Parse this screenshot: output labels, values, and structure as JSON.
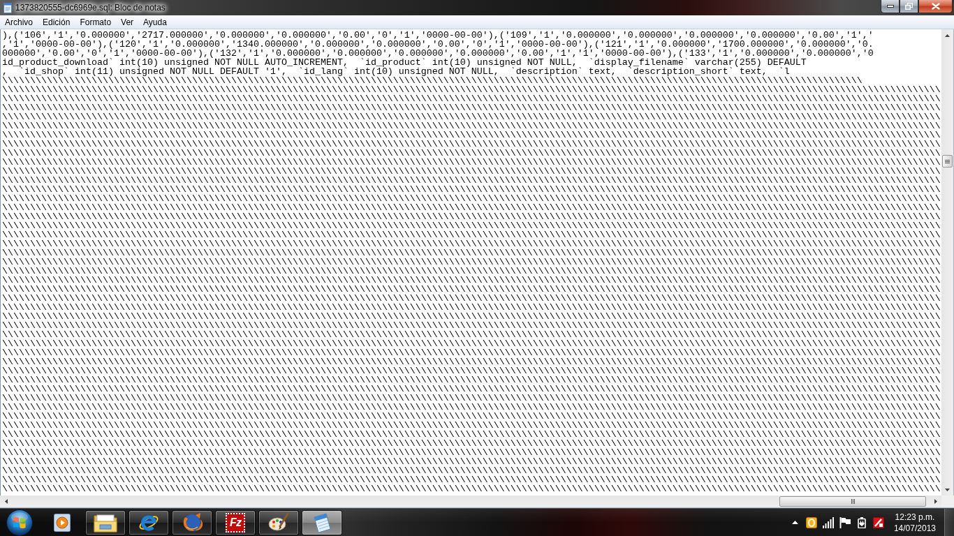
{
  "window": {
    "title": "1373820555-dc6969e.sql: Bloc de notas"
  },
  "menu": [
    "Archivo",
    "Edición",
    "Formato",
    "Ver",
    "Ayuda"
  ],
  "editor": {
    "lines": [
      {
        "parts": [
          "),('106','1','0.000000','2717.000000','0.000000','0.000000','0.00','0','1','0000-00-00'),('109','1','0.000000','0.000000','0.000000','0.000000','0.00','1','"
        ]
      },
      {
        "parts": [
          ",'1','0000-00-00'),('120','1','0.000000','1340.000000','0.000000','0.000000','0.00','0','1','0000-00-00'),('121','1','0.000000','1700.000000','0.000000','0."
        ]
      },
      {
        "parts": [
          "000000','0.00','0','1','0000-00-00'),('132','1','0.000000','0.000000','0.000000','0.000000','0.00','1','1','0000-00-00'),('133','1','0.000000','0.000000','0"
        ]
      },
      {
        "parts": [
          "id_product_download` int(10) unsigned NOT NULL AUTO_INCREMENT,  `id_product` int(10) unsigned NOT NULL,  `display_filename` varchar(255) DEFAULT"
        ]
      },
      {
        "parts": [
          ",  `id_shop` int(11) unsigned NOT NULL DEFAULT '1',  `id_lang` int(10) unsigned NOT NULL,  `description` text,  `description_short` text,  `l"
        ]
      },
      {
        "parts": [
          "\\\\\\\\\\\\\\\\",
          "\\\\\\\\\\\\\\\\",
          "\\\\\\\\\\\\\\\\",
          "\\\\\\\\\\\\\\\\",
          "\\\\\\\\\\\\\\\\",
          "\\\\\\\\\\\\\\\\",
          "\\\\\\\\\\\\\\\\",
          "\\\\\\\\\\\\\\\\",
          "\\\\\\\\\\\\\\\\",
          "\\\\\\\\\\\\\\\\",
          "\\\\\\\\\\\\\\\\",
          "\\\\\\\\\\\\\\\\",
          "\\\\\\\\\\\\\\\\",
          "\\\\\\\\\\\\\\\\",
          "\\\\\\\\\\\\\\\\",
          "\\\\\\\\\\\\\\\\",
          "\\\\\\\\\\\\\\\\",
          "\\\\\\\\\\\\\\\\",
          "\\\\\\\\\\\\\\\\",
          "\\\\"
        ]
      },
      {
        "parts": [
          "\\\\\\\\\\\\\\\\",
          "\\\\\\\\\\\\\\\\",
          "\\\\\\\\\\\\\\\\",
          "\\\\\\\\\\\\\\\\",
          "\\\\\\\\\\\\\\\\",
          "\\\\\\\\\\\\\\\\",
          "\\\\\\\\\\\\\\\\",
          "\\\\\\\\\\\\\\\\",
          "\\\\\\\\\\\\\\\\",
          "\\\\\\\\\\\\\\\\",
          "\\\\\\\\\\\\\\\\",
          "\\\\\\\\\\\\\\\\",
          "\\\\\\\\\\\\\\\\",
          "\\\\\\\\\\\\\\\\",
          "\\\\\\\\\\\\\\\\",
          "\\\\\\\\\\\\\\\\",
          "\\\\\\\\\\\\\\\\",
          "\\\\\\\\\\\\\\\\",
          "\\\\\\\\\\\\\\\\",
          "\\\\\\\\\\\\\\\\",
          "\\\\\\\\\\\\\\\\"
        ]
      },
      {
        "parts": [
          "\\\\\\\\\\\\\\\\",
          "\\\\\\\\\\\\\\\\",
          "\\\\\\\\\\\\\\\\",
          "\\\\\\\\\\\\\\\\",
          "\\\\\\\\\\\\\\\\",
          "\\\\\\\\\\\\\\\\",
          "\\\\\\\\\\\\\\\\",
          "\\\\\\\\\\\\\\\\",
          "\\\\\\\\\\\\\\\\",
          "\\\\\\\\\\\\\\\\",
          "\\\\\\\\\\\\\\\\",
          "\\\\\\\\\\\\\\\\",
          "\\\\\\\\\\\\\\\\",
          "\\\\\\\\\\\\\\\\",
          "\\\\\\\\\\\\\\\\",
          "\\\\\\\\\\\\\\\\",
          "\\\\\\\\\\\\\\\\",
          "\\\\\\\\\\\\\\\\",
          "\\\\\\\\\\\\\\\\",
          "\\\\\\\\\\\\\\\\",
          "\\\\\\\\\\\\\\\\"
        ]
      },
      {
        "parts": [
          "\\\\\\\\\\\\\\\\",
          "\\\\\\\\\\\\\\\\",
          "\\\\\\\\\\\\\\\\",
          "\\\\\\\\\\\\\\\\",
          "\\\\\\\\\\\\\\\\",
          "\\\\\\\\\\\\\\\\",
          "\\\\\\\\\\\\\\\\",
          "\\\\\\\\\\\\\\\\",
          "\\\\\\\\\\\\\\\\",
          "\\\\\\\\\\\\\\\\",
          "\\\\\\\\\\\\\\\\",
          "\\\\\\\\\\\\\\\\",
          "\\\\\\\\\\\\\\\\",
          "\\\\\\\\\\\\\\\\",
          "\\\\\\\\\\\\\\\\",
          "\\\\\\\\\\\\\\\\",
          "\\\\\\\\\\\\\\\\",
          "\\\\\\\\\\\\\\\\",
          "\\\\\\\\\\\\\\\\",
          "\\\\\\\\\\\\\\\\",
          "\\\\\\\\\\\\\\\\"
        ]
      },
      {
        "parts": [
          "\\\\\\\\\\\\\\\\",
          "\\\\\\\\\\\\\\\\",
          "\\\\\\\\\\\\\\\\",
          "\\\\\\\\\\\\\\\\",
          "\\\\\\\\\\\\\\\\",
          "\\\\\\\\\\\\\\\\",
          "\\\\\\\\\\\\\\\\",
          "\\\\\\\\\\\\\\\\",
          "\\\\\\\\\\\\\\\\",
          "\\\\\\\\\\\\\\\\",
          "\\\\\\\\\\\\\\\\",
          "\\\\\\\\\\\\\\\\",
          "\\\\\\\\\\\\\\\\",
          "\\\\\\\\\\\\\\\\",
          "\\\\\\\\\\\\\\\\",
          "\\\\\\\\\\\\\\\\",
          "\\\\\\\\\\\\\\\\",
          "\\\\\\\\\\\\\\\\",
          "\\\\\\\\\\\\\\\\",
          "\\\\\\\\\\\\\\\\",
          "\\\\\\\\\\\\\\\\"
        ]
      },
      {
        "parts": [
          "\\\\\\\\\\\\\\\\",
          "\\\\\\\\\\\\\\\\",
          "\\\\\\\\\\\\\\\\",
          "\\\\\\\\\\\\\\\\",
          "\\\\\\\\\\\\\\\\",
          "\\\\\\\\\\\\\\\\",
          "\\\\\\\\\\\\\\\\",
          "\\\\\\\\\\\\\\\\",
          "\\\\\\\\\\\\\\\\",
          "\\\\\\\\\\\\\\\\",
          "\\\\\\\\\\\\\\\\",
          "\\\\\\\\\\\\\\\\",
          "\\\\\\\\\\\\\\\\",
          "\\\\\\\\\\\\\\\\",
          "\\\\\\\\\\\\\\\\",
          "\\\\\\\\\\\\\\\\",
          "\\\\\\\\\\\\\\\\",
          "\\\\\\\\\\\\\\\\",
          "\\\\\\\\\\\\\\\\",
          "\\\\\\\\\\\\\\\\",
          "\\\\\\\\\\\\\\\\"
        ]
      },
      {
        "parts": [
          "\\\\\\\\\\\\\\\\",
          "\\\\\\\\\\\\\\\\",
          "\\\\\\\\\\\\\\\\",
          "\\\\\\\\\\\\\\\\",
          "\\\\\\\\\\\\\\\\",
          "\\\\\\\\\\\\\\\\",
          "\\\\\\\\\\\\\\\\",
          "\\\\\\\\\\\\\\\\",
          "\\\\\\\\\\\\\\\\",
          "\\\\\\\\\\\\\\\\",
          "\\\\\\\\\\\\\\\\",
          "\\\\\\\\\\\\\\\\",
          "\\\\\\\\\\\\\\\\",
          "\\\\\\\\\\\\\\\\",
          "\\\\\\\\\\\\\\\\",
          "\\\\\\\\\\\\\\\\",
          "\\\\\\\\\\\\\\\\",
          "\\\\\\\\\\\\\\\\",
          "\\\\\\\\\\\\\\\\",
          "\\\\\\\\\\\\\\\\",
          "\\\\\\\\\\\\\\\\"
        ]
      },
      {
        "parts": [
          "\\\\\\\\\\\\\\\\",
          "\\\\\\\\\\\\\\\\",
          "\\\\\\\\\\\\\\\\",
          "\\\\\\\\\\\\\\\\",
          "\\\\\\\\\\\\\\\\",
          "\\\\\\\\\\\\\\\\",
          "\\\\\\\\\\\\\\\\",
          "\\\\\\\\\\\\\\\\",
          "\\\\\\\\\\\\\\\\",
          "\\\\\\\\\\\\\\\\",
          "\\\\\\\\\\\\\\\\",
          "\\\\\\\\\\\\\\\\",
          "\\\\\\\\\\\\\\\\",
          "\\\\\\\\\\\\\\\\",
          "\\\\\\\\\\\\\\\\",
          "\\\\\\\\\\\\\\\\",
          "\\\\\\\\\\\\\\\\",
          "\\\\\\\\\\\\\\\\",
          "\\\\\\\\\\\\\\\\",
          "\\\\\\\\\\\\\\\\",
          "\\\\\\\\\\\\\\\\"
        ]
      },
      {
        "parts": [
          "\\\\\\\\\\\\\\\\",
          "\\\\\\\\\\\\\\\\",
          "\\\\\\\\\\\\\\\\",
          "\\\\\\\\\\\\\\\\",
          "\\\\\\\\\\\\\\\\",
          "\\\\\\\\\\\\\\\\",
          "\\\\\\\\\\\\\\\\",
          "\\\\\\\\\\\\\\\\",
          "\\\\\\\\\\\\\\\\",
          "\\\\\\\\\\\\\\\\",
          "\\\\\\\\\\\\\\\\",
          "\\\\\\\\\\\\\\\\",
          "\\\\\\\\\\\\\\\\",
          "\\\\\\\\\\\\\\\\",
          "\\\\\\\\\\\\\\\\",
          "\\\\\\\\\\\\\\\\",
          "\\\\\\\\\\\\\\\\",
          "\\\\\\\\\\\\\\\\",
          "\\\\\\\\\\\\\\\\",
          "\\\\\\\\\\\\\\\\",
          "\\\\\\\\\\\\\\\\"
        ]
      },
      {
        "parts": [
          "\\\\\\\\\\\\\\\\",
          "\\\\\\\\\\\\\\\\",
          "\\\\\\\\\\\\\\\\",
          "\\\\\\\\\\\\\\\\",
          "\\\\\\\\\\\\\\\\",
          "\\\\\\\\\\\\\\\\",
          "\\\\\\\\\\\\\\\\",
          "\\\\\\\\\\\\\\\\",
          "\\\\\\\\\\\\\\\\",
          "\\\\\\\\\\\\\\\\",
          "\\\\\\\\\\\\\\\\",
          "\\\\\\\\\\\\\\\\",
          "\\\\\\\\\\\\\\\\",
          "\\\\\\\\\\\\\\\\",
          "\\\\\\\\\\\\\\\\",
          "\\\\\\\\\\\\\\\\",
          "\\\\\\\\\\\\\\\\",
          "\\\\\\\\\\\\\\\\",
          "\\\\\\\\\\\\\\\\",
          "\\\\\\\\\\\\\\\\",
          "\\\\\\\\\\\\\\\\"
        ]
      },
      {
        "parts": [
          "\\\\\\\\\\\\\\\\",
          "\\\\\\\\\\\\\\\\",
          "\\\\\\\\\\\\\\\\",
          "\\\\\\\\\\\\\\\\",
          "\\\\\\\\\\\\\\\\",
          "\\\\\\\\\\\\\\\\",
          "\\\\\\\\\\\\\\\\",
          "\\\\\\\\\\\\\\\\",
          "\\\\\\\\\\\\\\\\",
          "\\\\\\\\\\\\\\\\",
          "\\\\\\\\\\\\\\\\",
          "\\\\\\\\\\\\\\\\",
          "\\\\\\\\\\\\\\\\",
          "\\\\\\\\\\\\\\\\",
          "\\\\\\\\\\\\\\\\",
          "\\\\\\\\\\\\\\\\",
          "\\\\\\\\\\\\\\\\",
          "\\\\\\\\\\\\\\\\",
          "\\\\\\\\\\\\\\\\",
          "\\\\\\\\\\\\\\\\",
          "\\\\\\\\\\\\\\\\"
        ]
      },
      {
        "parts": [
          "\\\\\\\\\\\\\\\\",
          "\\\\\\\\\\\\\\\\",
          "\\\\\\\\\\\\\\\\",
          "\\\\\\\\\\\\\\\\",
          "\\\\\\\\\\\\\\\\",
          "\\\\\\\\\\\\\\\\",
          "\\\\\\\\\\\\\\\\",
          "\\\\\\\\\\\\\\\\",
          "\\\\\\\\\\\\\\\\",
          "\\\\\\\\\\\\\\\\",
          "\\\\\\\\\\\\\\\\",
          "\\\\\\\\\\\\\\\\",
          "\\\\\\\\\\\\\\\\",
          "\\\\\\\\\\\\\\\\",
          "\\\\\\\\\\\\\\\\",
          "\\\\\\\\\\\\\\\\",
          "\\\\\\\\\\\\\\\\",
          "\\\\\\\\\\\\\\\\",
          "\\\\\\\\\\\\\\\\",
          "\\\\\\\\\\\\\\\\",
          "\\\\\\\\\\\\\\\\"
        ]
      },
      {
        "parts": [
          "\\\\\\\\\\\\\\\\",
          "\\\\\\\\\\\\\\\\",
          "\\\\\\\\\\\\\\\\",
          "\\\\\\\\\\\\\\\\",
          "\\\\\\\\\\\\\\\\",
          "\\\\\\\\\\\\\\\\",
          "\\\\\\\\\\\\\\\\",
          "\\\\\\\\\\\\\\\\",
          "\\\\\\\\\\\\\\\\",
          "\\\\\\\\\\\\\\\\",
          "\\\\\\\\\\\\\\\\",
          "\\\\\\\\\\\\\\\\",
          "\\\\\\\\\\\\\\\\",
          "\\\\\\\\\\\\\\\\",
          "\\\\\\\\\\\\\\\\",
          "\\\\\\\\\\\\\\\\",
          "\\\\\\\\\\\\\\\\",
          "\\\\\\\\\\\\\\\\",
          "\\\\\\\\\\\\\\\\",
          "\\\\\\\\\\\\\\\\",
          "\\\\\\\\\\\\\\\\"
        ]
      },
      {
        "parts": [
          "\\\\\\\\\\\\\\\\",
          "\\\\\\\\\\\\\\\\",
          "\\\\\\\\\\\\\\\\",
          "\\\\\\\\\\\\\\\\",
          "\\\\\\\\\\\\\\\\",
          "\\\\\\\\\\\\\\\\",
          "\\\\\\\\\\\\\\\\",
          "\\\\\\\\\\\\\\\\",
          "\\\\\\\\\\\\\\\\",
          "\\\\\\\\\\\\\\\\",
          "\\\\\\\\\\\\\\\\",
          "\\\\\\\\\\\\\\\\",
          "\\\\\\\\\\\\\\\\",
          "\\\\\\\\\\\\\\\\",
          "\\\\\\\\\\\\\\\\",
          "\\\\\\\\\\\\\\\\",
          "\\\\\\\\\\\\\\\\",
          "\\\\\\\\\\\\\\\\",
          "\\\\\\\\\\\\\\\\",
          "\\\\\\\\\\\\\\\\",
          "\\\\\\\\\\\\\\\\"
        ]
      },
      {
        "parts": [
          "\\\\\\\\\\\\\\\\",
          "\\\\\\\\\\\\\\\\",
          "\\\\\\\\\\\\\\\\",
          "\\\\\\\\\\\\\\\\",
          "\\\\\\\\\\\\\\\\",
          "\\\\\\\\\\\\\\\\",
          "\\\\\\\\\\\\\\\\",
          "\\\\\\\\\\\\\\\\",
          "\\\\\\\\\\\\\\\\",
          "\\\\\\\\\\\\\\\\",
          "\\\\\\\\\\\\\\\\",
          "\\\\\\\\\\\\\\\\",
          "\\\\\\\\\\\\\\\\",
          "\\\\\\\\\\\\\\\\",
          "\\\\\\\\\\\\\\\\",
          "\\\\\\\\\\\\\\\\",
          "\\\\\\\\\\\\\\\\",
          "\\\\\\\\\\\\\\\\",
          "\\\\\\\\\\\\\\\\",
          "\\\\\\\\\\\\\\\\",
          "\\\\\\\\\\\\\\\\"
        ]
      },
      {
        "parts": [
          "\\\\\\\\\\\\\\\\",
          "\\\\\\\\\\\\\\\\",
          "\\\\\\\\\\\\\\\\",
          "\\\\\\\\\\\\\\\\",
          "\\\\\\\\\\\\\\\\",
          "\\\\\\\\\\\\\\\\",
          "\\\\\\\\\\\\\\\\",
          "\\\\\\\\\\\\\\\\",
          "\\\\\\\\\\\\\\\\",
          "\\\\\\\\\\\\\\\\",
          "\\\\\\\\\\\\\\\\",
          "\\\\\\\\\\\\\\\\",
          "\\\\\\\\\\\\\\\\",
          "\\\\\\\\\\\\\\\\",
          "\\\\\\\\\\\\\\\\",
          "\\\\\\\\\\\\\\\\",
          "\\\\\\\\\\\\\\\\",
          "\\\\\\\\\\\\\\\\",
          "\\\\\\\\\\\\\\\\",
          "\\\\\\\\\\\\\\\\",
          "\\\\\\\\\\\\\\\\"
        ]
      },
      {
        "parts": [
          "\\\\\\\\\\\\\\\\",
          "\\\\\\\\\\\\\\\\",
          "\\\\\\\\\\\\\\\\",
          "\\\\\\\\\\\\\\\\",
          "\\\\\\\\\\\\\\\\",
          "\\\\\\\\\\\\\\\\",
          "\\\\\\\\\\\\\\\\",
          "\\\\\\\\\\\\\\\\",
          "\\\\\\\\\\\\\\\\",
          "\\\\\\\\\\\\\\\\",
          "\\\\\\\\\\\\\\\\",
          "\\\\\\\\\\\\\\\\",
          "\\\\\\\\\\\\\\\\",
          "\\\\\\\\\\\\\\\\",
          "\\\\\\\\\\\\\\\\",
          "\\\\\\\\\\\\\\\\",
          "\\\\\\\\\\\\\\\\",
          "\\\\\\\\\\\\\\\\",
          "\\\\\\\\\\\\\\\\",
          "\\\\\\\\\\\\\\\\",
          "\\\\\\\\\\\\\\\\"
        ]
      },
      {
        "parts": [
          "\\\\\\\\\\\\\\\\",
          "\\\\\\\\\\\\\\\\",
          "\\\\\\\\\\\\\\\\",
          "\\\\\\\\\\\\\\\\",
          "\\\\\\\\\\\\\\\\",
          "\\\\\\\\\\\\\\\\",
          "\\\\\\\\\\\\\\\\",
          "\\\\\\\\\\\\\\\\",
          "\\\\\\\\\\\\\\\\",
          "\\\\\\\\\\\\\\\\",
          "\\\\\\\\\\\\\\\\",
          "\\\\\\\\\\\\\\\\",
          "\\\\\\\\\\\\\\\\",
          "\\\\\\\\\\\\\\\\",
          "\\\\\\\\\\\\\\\\",
          "\\\\\\\\\\\\\\\\",
          "\\\\\\\\\\\\\\\\",
          "\\\\\\\\\\\\\\\\",
          "\\\\\\\\\\\\\\\\",
          "\\\\\\\\\\\\\\\\",
          "\\\\\\\\\\\\\\\\"
        ]
      },
      {
        "parts": [
          "\\\\\\\\\\\\\\\\",
          "\\\\\\\\\\\\\\\\",
          "\\\\\\\\\\\\\\\\",
          "\\\\\\\\\\\\\\\\",
          "\\\\\\\\\\\\\\\\",
          "\\\\\\\\\\\\\\\\",
          "\\\\\\\\\\\\\\\\",
          "\\\\\\\\\\\\\\\\",
          "\\\\\\\\\\\\\\\\",
          "\\\\\\\\\\\\\\\\",
          "\\\\\\\\\\\\\\\\",
          "\\\\\\\\\\\\\\\\",
          "\\\\\\\\\\\\\\\\",
          "\\\\\\\\\\\\\\\\",
          "\\\\\\\\\\\\\\\\",
          "\\\\\\\\\\\\\\\\",
          "\\\\\\\\\\\\\\\\",
          "\\\\\\\\\\\\\\\\",
          "\\\\\\\\\\\\\\\\",
          "\\\\\\\\\\\\\\\\",
          "\\\\\\\\\\\\\\\\"
        ]
      },
      {
        "parts": [
          "\\\\\\\\\\\\\\\\",
          "\\\\\\\\\\\\\\\\",
          "\\\\\\\\\\\\\\\\",
          "\\\\\\\\\\\\\\\\",
          "\\\\\\\\\\\\\\\\",
          "\\\\\\\\\\\\\\\\",
          "\\\\\\\\\\\\\\\\",
          "\\\\\\\\\\\\\\\\",
          "\\\\\\\\\\\\\\\\",
          "\\\\\\\\\\\\\\\\",
          "\\\\\\\\\\\\\\\\",
          "\\\\\\\\\\\\\\\\",
          "\\\\\\\\\\\\\\\\",
          "\\\\\\\\\\\\\\\\",
          "\\\\\\\\\\\\\\\\",
          "\\\\\\\\\\\\\\\\",
          "\\\\\\\\\\\\\\\\",
          "\\\\\\\\\\\\\\\\",
          "\\\\\\\\\\\\\\\\",
          "\\\\\\\\\\\\\\\\",
          "\\\\\\\\\\\\\\\\"
        ]
      },
      {
        "parts": [
          "\\\\\\\\\\\\\\\\",
          "\\\\\\\\\\\\\\\\",
          "\\\\\\\\\\\\\\\\",
          "\\\\\\\\\\\\\\\\",
          "\\\\\\\\\\\\\\\\",
          "\\\\\\\\\\\\\\\\",
          "\\\\\\\\\\\\\\\\",
          "\\\\\\\\\\\\\\\\",
          "\\\\\\\\\\\\\\\\",
          "\\\\\\\\\\\\\\\\",
          "\\\\\\\\\\\\\\\\",
          "\\\\\\\\\\\\\\\\",
          "\\\\\\\\\\\\\\\\",
          "\\\\\\\\\\\\\\\\",
          "\\\\\\\\\\\\\\\\",
          "\\\\\\\\\\\\\\\\",
          "\\\\\\\\\\\\\\\\",
          "\\\\\\\\\\\\\\\\",
          "\\\\\\\\\\\\\\\\",
          "\\\\\\\\\\\\\\\\",
          "\\\\\\\\\\\\\\\\"
        ]
      },
      {
        "parts": [
          "\\\\\\\\\\\\\\\\",
          "\\\\\\\\\\\\\\\\",
          "\\\\\\\\\\\\\\\\",
          "\\\\\\\\\\\\\\\\",
          "\\\\\\\\\\\\\\\\",
          "\\\\\\\\\\\\\\\\",
          "\\\\\\\\\\\\\\\\",
          "\\\\\\\\\\\\\\\\",
          "\\\\\\\\\\\\\\\\",
          "\\\\\\\\\\\\\\\\",
          "\\\\\\\\\\\\\\\\",
          "\\\\\\\\\\\\\\\\",
          "\\\\\\\\\\\\\\\\",
          "\\\\\\\\\\\\\\\\",
          "\\\\\\\\\\\\\\\\",
          "\\\\\\\\\\\\\\\\",
          "\\\\\\\\\\\\\\\\",
          "\\\\\\\\\\\\\\\\",
          "\\\\\\\\\\\\\\\\",
          "\\\\\\\\\\\\\\\\",
          "\\\\\\\\\\\\\\\\"
        ]
      },
      {
        "parts": [
          "\\\\\\\\\\\\\\\\",
          "\\\\\\\\\\\\\\\\",
          "\\\\\\\\\\\\\\\\",
          "\\\\\\\\\\\\\\\\",
          "\\\\\\\\\\\\\\\\",
          "\\\\\\\\\\\\\\\\",
          "\\\\\\\\\\\\\\\\",
          "\\\\\\\\\\\\\\\\",
          "\\\\\\\\\\\\\\\\",
          "\\\\\\\\\\\\\\\\",
          "\\\\\\\\\\\\\\\\",
          "\\\\\\\\\\\\\\\\",
          "\\\\\\\\\\\\\\\\",
          "\\\\\\\\\\\\\\\\",
          "\\\\\\\\\\\\\\\\",
          "\\\\\\\\\\\\\\\\",
          "\\\\\\\\\\\\\\\\",
          "\\\\\\\\\\\\\\\\",
          "\\\\\\\\\\\\\\\\",
          "\\\\\\\\\\\\\\\\",
          "\\\\\\\\\\\\\\\\"
        ]
      },
      {
        "parts": [
          "\\\\\\\\\\\\\\\\",
          "\\\\\\\\\\\\\\\\",
          "\\\\\\\\\\\\\\\\",
          "\\\\\\\\\\\\\\\\",
          "\\\\\\\\\\\\\\\\",
          "\\\\\\\\\\\\\\\\",
          "\\\\\\\\\\\\\\\\",
          "\\\\\\\\\\\\\\\\",
          "\\\\\\\\\\\\\\\\",
          "\\\\\\\\\\\\\\\\",
          "\\\\\\\\\\\\\\\\",
          "\\\\\\\\\\\\\\\\",
          "\\\\\\\\\\\\\\\\",
          "\\\\\\\\\\\\\\\\",
          "\\\\\\\\\\\\\\\\",
          "\\\\\\\\\\\\\\\\",
          "\\\\\\\\\\\\\\\\",
          "\\\\\\\\\\\\\\\\",
          "\\\\\\\\\\\\\\\\",
          "\\\\\\\\\\\\\\\\",
          "\\\\\\\\\\\\\\\\"
        ]
      },
      {
        "parts": [
          "\\\\\\\\\\\\\\\\",
          "\\\\\\\\\\\\\\\\",
          "\\\\\\\\\\\\\\\\",
          "\\\\\\\\\\\\\\\\",
          "\\\\\\\\\\\\\\\\",
          "\\\\\\\\\\\\\\\\",
          "\\\\\\\\\\\\\\\\",
          "\\\\\\\\\\\\\\\\",
          "\\\\\\\\\\\\\\\\",
          "\\\\\\\\\\\\\\\\",
          "\\\\\\\\\\\\\\\\",
          "\\\\\\\\\\\\\\\\",
          "\\\\\\\\\\\\\\\\",
          "\\\\\\\\\\\\\\\\",
          "\\\\\\\\\\\\\\\\",
          "\\\\\\\\\\\\\\\\",
          "\\\\\\\\\\\\\\\\",
          "\\\\\\\\\\\\\\\\",
          "\\\\\\\\\\\\\\\\",
          "\\\\\\\\\\\\\\\\",
          "\\\\\\\\\\\\\\\\"
        ]
      },
      {
        "parts": [
          "\\\\\\\\\\\\\\\\",
          "\\\\\\\\\\\\\\\\",
          "\\\\\\\\\\\\\\\\",
          "\\\\\\\\\\\\\\\\",
          "\\\\\\\\\\\\\\\\",
          "\\\\\\\\\\\\\\\\",
          "\\\\\\\\\\\\\\\\",
          "\\\\\\\\\\\\\\\\",
          "\\\\\\\\\\\\\\\\",
          "\\\\\\\\\\\\\\\\",
          "\\\\\\\\\\\\\\\\",
          "\\\\\\\\\\\\\\\\",
          "\\\\\\\\\\\\\\\\",
          "\\\\\\\\\\\\\\\\",
          "\\\\\\\\\\\\\\\\",
          "\\\\\\\\\\\\\\\\",
          "\\\\\\\\\\\\\\\\",
          "\\\\\\\\\\\\\\\\",
          "\\\\\\\\\\\\\\\\",
          "\\\\\\\\\\\\\\\\",
          "\\\\\\\\\\\\\\\\"
        ]
      },
      {
        "parts": [
          "\\\\\\\\\\\\\\\\",
          "\\\\\\\\\\\\\\\\",
          "\\\\\\\\\\\\\\\\",
          "\\\\\\\\\\\\\\\\",
          "\\\\\\\\\\\\\\\\",
          "\\\\\\\\\\\\\\\\",
          "\\\\\\\\\\\\\\\\",
          "\\\\\\\\\\\\\\\\",
          "\\\\\\\\\\\\\\\\",
          "\\\\\\\\\\\\\\\\",
          "\\\\\\\\\\\\\\\\",
          "\\\\\\\\\\\\\\\\",
          "\\\\\\\\\\\\\\\\",
          "\\\\\\\\\\\\\\\\",
          "\\\\\\\\\\\\\\\\",
          "\\\\\\\\\\\\\\\\",
          "\\\\\\\\\\\\\\\\",
          "\\\\\\\\\\\\\\\\",
          "\\\\\\\\\\\\\\\\",
          "\\\\\\\\\\\\\\\\",
          "\\\\\\\\\\\\\\\\"
        ]
      },
      {
        "parts": [
          "\\\\\\\\\\\\\\\\",
          "\\\\\\\\\\\\\\\\",
          "\\\\\\\\\\\\\\\\",
          "\\\\\\\\\\\\\\\\",
          "\\\\\\\\\\\\\\\\",
          "\\\\\\\\\\\\\\\\",
          "\\\\\\\\\\\\\\\\",
          "\\\\\\\\\\\\\\\\",
          "\\\\\\\\\\\\\\\\",
          "\\\\\\\\\\\\\\\\",
          "\\\\\\\\\\\\\\\\",
          "\\\\\\\\\\\\\\\\",
          "\\\\\\\\\\\\\\\\",
          "\\\\\\\\\\\\\\\\",
          "\\\\\\\\\\\\\\\\",
          "\\\\\\\\\\\\\\\\",
          "\\\\\\\\\\\\\\\\",
          "\\\\\\\\\\\\\\\\",
          "\\\\\\\\\\\\\\\\",
          "\\\\\\\\\\\\\\\\",
          "\\\\\\\\\\\\\\\\"
        ]
      },
      {
        "parts": [
          "\\\\\\\\\\\\\\\\",
          "\\\\\\\\\\\\\\\\",
          "\\\\\\\\\\\\\\\\",
          "\\\\\\\\\\\\\\\\",
          "\\\\\\\\\\\\\\\\",
          "\\\\\\\\\\\\\\\\",
          "\\\\\\\\\\\\\\\\",
          "\\\\\\\\\\\\\\\\",
          "\\\\\\\\\\\\\\\\",
          "\\\\\\\\\\\\\\\\",
          "\\\\\\\\\\\\\\\\",
          "\\\\\\\\\\\\\\\\",
          "\\\\\\\\\\\\\\\\",
          "\\\\\\\\\\\\\\\\",
          "\\\\\\\\\\\\\\\\",
          "\\\\\\\\\\\\\\\\",
          "\\\\\\\\\\\\\\\\",
          "\\\\\\\\\\\\\\\\",
          "\\\\\\\\\\\\\\\\",
          "\\\\\\\\\\\\\\\\",
          "\\\\\\\\\\\\\\\\"
        ]
      },
      {
        "parts": [
          "\\\\\\\\\\\\\\\\",
          "\\\\\\\\\\\\\\\\",
          "\\\\\\\\\\\\\\\\",
          "\\\\\\\\\\\\\\\\",
          "\\\\\\\\\\\\\\\\",
          "\\\\\\\\\\\\\\\\",
          "\\\\\\\\\\\\\\\\",
          "\\\\\\\\\\\\\\\\",
          "\\\\\\\\\\\\\\\\",
          "\\\\\\\\\\\\\\\\",
          "\\\\\\\\\\\\\\\\",
          "\\\\\\\\\\\\\\\\",
          "\\\\\\\\\\\\\\\\",
          "\\\\\\\\\\\\\\\\",
          "\\\\\\\\\\\\\\\\",
          "\\\\\\\\\\\\\\\\",
          "\\\\\\\\\\\\\\\\",
          "\\\\\\\\\\\\\\\\",
          "\\\\\\\\\\\\\\\\",
          "\\\\\\\\\\\\\\\\",
          "\\\\\\\\\\\\\\\\"
        ]
      },
      {
        "parts": [
          "\\\\\\\\\\\\\\\\",
          "\\\\\\\\\\\\\\\\",
          "\\\\\\\\\\\\\\\\",
          "\\\\\\\\\\\\\\\\",
          "\\\\\\\\\\\\\\\\",
          "\\\\\\\\\\\\\\\\",
          "\\\\\\\\\\\\\\\\",
          "\\\\\\\\\\\\\\\\",
          "\\\\\\\\\\\\\\\\",
          "\\\\\\\\\\\\\\\\",
          "\\\\\\\\\\\\\\\\",
          "\\\\\\\\\\\\\\\\",
          "\\\\\\\\\\\\\\\\",
          "\\\\\\\\\\\\\\\\",
          "\\\\\\\\\\\\\\\\",
          "\\\\\\\\\\\\\\\\",
          "\\\\\\\\\\\\\\\\",
          "\\\\\\\\\\\\\\\\",
          "\\\\\\\\\\\\\\\\",
          "\\\\\\\\\\\\\\\\",
          "\\\\\\\\\\\\\\\\"
        ]
      },
      {
        "parts": [
          "\\\\\\\\\\\\\\\\",
          "\\\\\\\\\\\\\\\\",
          "\\\\\\\\\\\\\\\\",
          "\\\\\\\\\\\\\\\\",
          "\\\\\\\\\\\\\\\\",
          "\\\\\\\\\\\\\\\\",
          "\\\\\\\\\\\\\\\\",
          "\\\\\\\\\\\\\\\\",
          "\\\\\\\\\\\\\\\\",
          "\\\\\\\\\\\\\\\\",
          "\\\\\\\\\\\\\\\\",
          "\\\\\\\\\\\\\\\\",
          "\\\\\\\\\\\\\\\\",
          "\\\\\\\\\\\\\\\\",
          "\\\\\\\\\\\\\\\\",
          "\\\\\\\\\\\\\\\\",
          "\\\\\\\\\\\\\\\\",
          "\\\\\\\\\\\\\\\\",
          "\\\\\\\\\\\\\\\\",
          "\\\\\\\\\\\\\\\\",
          "\\\\\\\\\\\\\\\\"
        ]
      },
      {
        "parts": [
          "\\\\\\\\\\\\\\\\",
          "\\\\\\\\\\\\\\\\",
          "\\\\\\\\\\\\\\\\",
          "\\\\\\\\\\\\\\\\",
          "\\\\\\\\\\\\\\\\",
          "\\\\\\\\\\\\\\\\",
          "\\\\\\\\\\\\\\\\",
          "\\\\\\\\\\\\\\\\",
          "\\\\\\\\\\\\\\\\",
          "\\\\\\\\\\\\\\\\",
          "\\\\\\\\\\\\\\\\",
          "\\\\\\\\\\\\\\\\",
          "\\\\\\\\\\\\\\\\",
          "\\\\\\\\\\\\\\\\",
          "\\\\\\\\\\\\\\\\",
          "\\\\\\\\\\\\\\\\",
          "\\\\\\\\\\\\\\\\",
          "\\\\\\\\\\\\\\\\",
          "\\\\\\\\\\\\\\\\",
          "\\\\\\\\\\\\\\\\",
          "\\\\\\\\\\\\\\\\"
        ]
      },
      {
        "parts": [
          "\\\\\\\\\\\\\\\\",
          "\\\\\\\\\\\\\\\\",
          "\\\\\\\\\\\\\\\\",
          "\\\\\\\\\\\\\\\\",
          "\\\\\\\\\\\\\\\\",
          "\\\\\\\\\\\\\\\\",
          "\\\\\\\\\\\\\\\\",
          "\\\\\\\\\\\\\\\\",
          "\\\\\\\\\\\\\\\\",
          "\\\\\\\\\\\\\\\\",
          "\\\\\\\\\\\\\\\\",
          "\\\\\\\\\\\\\\\\",
          "\\\\\\\\\\\\\\\\",
          "\\\\\\\\\\\\\\\\",
          "\\\\\\\\\\\\\\\\",
          "\\\\\\\\\\\\\\\\",
          "\\\\\\\\\\\\\\\\",
          "\\\\\\\\\\\\\\\\",
          "\\\\\\\\\\\\\\\\",
          "\\\\\\\\\\\\\\\\",
          "\\\\\\\\\\\\\\\\"
        ]
      },
      {
        "parts": [
          "\\\\\\\\\\\\\\\\",
          "\\\\\\\\\\\\\\\\",
          "\\\\\\\\\\\\\\\\",
          "\\\\\\\\\\\\\\\\",
          "\\\\\\\\\\\\\\\\",
          "\\\\\\\\\\\\\\\\",
          "\\\\\\\\\\\\\\\\",
          "\\\\\\\\\\\\\\\\",
          "\\\\\\\\\\\\\\\\",
          "\\\\\\\\\\\\\\\\",
          "\\\\\\\\\\\\\\\\",
          "\\\\\\\\\\\\\\\\",
          "\\\\\\\\\\\\\\\\",
          "\\\\\\\\\\\\\\\\",
          "\\\\\\\\\\\\\\\\",
          "\\\\\\\\\\\\\\\\",
          "\\\\\\\\\\\\\\\\",
          "\\\\\\\\\\\\\\\\",
          "\\\\\\\\\\\\\\\\",
          "\\\\\\\\\\\\\\\\",
          "\\\\\\\\\\\\\\\\"
        ]
      },
      {
        "parts": [
          "\\\\\\\\\\\\\\\\",
          "\\\\\\\\\\\\\\\\",
          "\\\\\\\\\\\\\\\\",
          "\\\\\\\\\\\\\\\\",
          "\\\\\\\\\\\\\\\\",
          "\\\\\\\\\\\\\\\\",
          "\\\\\\\\\\\\\\\\",
          "\\\\\\\\\\\\\\\\",
          "\\\\\\\\\\\\\\\\",
          "\\\\\\\\\\\\\\\\",
          "\\\\\\\\\\\\\\\\",
          "\\\\\\\\\\\\\\\\",
          "\\\\\\\\\\\\\\\\",
          "\\\\\\\\\\\\\\\\",
          "\\\\\\\\\\\\\\\\",
          "\\\\\\\\\\\\\\\\",
          "\\\\\\\\\\\\\\\\",
          "\\\\\\\\\\\\\\\\",
          "\\\\\\\\\\\\\\\\",
          "\\\\\\\\\\\\\\\\",
          "\\\\\\\\\\\\\\\\"
        ]
      },
      {
        "parts": [
          "\\\\\\\\\\\\\\\\",
          "\\\\\\\\\\\\\\\\",
          "\\\\\\\\\\\\\\\\",
          "\\\\\\\\\\\\\\\\",
          "\\\\\\\\\\\\\\\\",
          "\\\\\\\\\\\\\\\\",
          "\\\\\\\\\\\\\\\\",
          "\\\\\\\\\\\\\\\\",
          "\\\\\\\\\\\\\\\\",
          "\\\\\\\\\\\\\\\\",
          "\\\\\\\\\\\\\\\\",
          "\\\\\\\\\\\\\\\\",
          "\\\\\\\\\\\\\\\\",
          "\\\\\\\\\\\\\\\\",
          "\\\\\\\\\\\\\\\\",
          "\\\\\\\\\\\\\\\\",
          "\\\\\\\\\\\\\\\\",
          "\\\\\\\\\\\\\\\\",
          "\\\\\\\\\\\\\\\\",
          "\\\\\\\\\\\\\\\\",
          "\\\\\\\\\\\\\\\\"
        ]
      },
      {
        "parts": [
          "\\\\\\\\\\\\\\\\",
          "\\\\\\\\\\\\\\\\",
          "\\\\\\\\\\\\\\\\",
          "\\\\\\\\\\\\\\\\",
          "\\\\\\\\\\\\\\\\",
          "\\\\\\\\\\\\\\\\",
          "\\\\\\\\\\\\\\\\",
          "\\\\\\\\\\\\\\\\",
          "\\\\\\\\\\\\\\\\",
          "\\\\\\\\\\\\\\\\",
          "\\\\\\\\\\\\\\\\",
          "\\\\\\\\\\\\\\\\",
          "\\\\\\\\\\\\\\\\",
          "\\\\\\\\\\\\\\\\",
          "\\\\\\\\\\\\\\\\",
          "\\\\\\\\\\\\\\\\",
          "\\\\\\\\\\\\\\\\",
          "\\\\\\\\\\\\\\\\",
          "\\\\\\\\\\\\\\\\",
          "\\\\\\\\\\\\\\\\",
          "\\\\\\\\\\\\\\\\"
        ]
      },
      {
        "parts": [
          "\\\\\\\\\\\\\\\\",
          "\\\\\\\\\\\\\\\\",
          "\\\\\\\\\\\\\\\\",
          "\\\\\\\\\\\\\\\\",
          "\\\\\\\\\\\\\\\\",
          "\\\\\\\\\\\\\\\\",
          "\\\\\\\\\\\\\\\\",
          "\\\\\\\\\\\\\\\\",
          "\\\\\\\\\\\\\\\\",
          "\\\\\\\\\\\\\\\\",
          "\\\\\\\\\\\\\\\\",
          "\\\\\\\\\\\\\\\\",
          "\\\\\\\\\\\\\\\\",
          "\\\\\\\\\\\\\\\\",
          "\\\\\\\\\\\\\\\\",
          "\\\\\\\\\\\\\\\\",
          "\\\\\\\\\\\\\\\\",
          "\\\\\\\\\\\\\\\\",
          "\\\\\\\\\\\\\\\\",
          "\\\\\\\\\\\\\\\\",
          "\\\\\\\\\\\\\\\\"
        ]
      },
      {
        "parts": [
          "\\\\\\\\\\\\\\\\",
          "\\\\\\\\\\\\\\\\",
          "\\\\\\\\\\\\\\\\",
          "\\\\\\\\\\\\\\\\",
          "\\\\\\\\\\\\\\\\",
          "\\\\\\\\\\\\\\\\",
          "\\\\\\\\\\\\\\\\",
          "\\\\\\\\\\\\\\\\",
          "\\\\\\\\\\\\\\\\",
          "\\\\\\\\\\\\\\\\",
          "\\\\\\\\\\\\\\\\",
          "\\\\\\\\\\\\\\\\",
          "\\\\\\\\\\\\\\\\",
          "\\\\\\\\\\\\\\\\",
          "\\\\\\\\\\\\\\\\",
          "\\\\\\\\\\\\\\\\",
          "\\\\\\\\\\\\\\\\",
          "\\\\\\\\\\\\\\\\",
          "\\\\\\\\\\\\\\\\",
          "\\\\\\\\\\\\\\\\",
          "\\\\\\\\\\\\\\\\"
        ]
      },
      {
        "parts": [
          "\\\\\\\\\\\\\\\\",
          "\\\\\\\\\\\\\\\\",
          "\\\\\\\\\\\\\\\\",
          "\\\\\\\\\\\\\\\\",
          "\\\\\\\\\\\\\\\\",
          "\\\\\\\\\\\\\\\\",
          "\\\\\\\\\\\\\\\\",
          "\\\\\\\\\\\\\\\\",
          "\\\\\\\\\\\\\\\\",
          "\\\\\\\\\\\\\\\\",
          "\\\\\\\\\\\\\\\\",
          "\\\\\\\\\\\\\\\\",
          "\\\\\\\\\\\\\\\\",
          "\\\\\\\\\\\\\\\\",
          "\\\\\\\\\\\\\\\\",
          "\\\\\\\\\\\\\\\\",
          "\\\\\\\\\\\\\\\\",
          "\\\\\\\\\\\\\\\\",
          "\\\\\\\\\\\\\\\\",
          "\\\\\\\\\\\\\\\\",
          "\\\\\\\\\\\\\\\\"
        ]
      },
      {
        "parts": [
          "\\\\\\\\\\\\\\\\",
          "\\\\\\\\\\\\\\\\",
          "\\\\\\\\\\\\\\\\",
          "\\\\\\\\\\\\\\\\",
          "\\\\\\\\\\\\\\\\",
          "\\\\\\\\\\\\\\\\",
          "\\\\\\\\\\\\\\\\",
          "\\\\\\\\\\\\\\\\",
          "\\\\\\\\\\\\\\\\",
          "\\\\\\\\\\\\\\\\",
          "\\\\\\\\\\\\\\\\",
          "\\\\\\\\\\\\\\\\",
          "\\\\\\\\\\\\\\\\",
          "\\\\\\\\\\\\\\\\",
          "\\\\\\\\\\\\\\\\",
          "\\\\\\\\\\\\\\\\",
          "\\\\\\\\\\\\\\\\",
          "\\\\\\\\\\\\\\\\",
          "\\\\\\\\\\\\\\\\",
          "\\\\\\\\\\\\\\\\",
          "\\\\\\\\\\\\\\\\"
        ]
      },
      {
        "parts": [
          "\\\\\\\\\\\\\\\\",
          "\\\\\\\\\\\\\\\\",
          "\\\\\\\\\\\\\\\\",
          "\\\\\\\\\\\\\\\\",
          "\\\\\\\\\\\\\\\\",
          "\\\\\\\\\\\\\\\\",
          "\\\\\\\\\\\\\\\\",
          "\\\\\\\\\\\\\\\\",
          "\\\\\\\\\\\\\\\\",
          "\\\\\\\\\\\\\\\\",
          "\\\\\\\\\\\\\\\\",
          "\\\\\\\\\\\\\\\\",
          "\\\\\\\\\\\\\\\\",
          "\\\\\\\\\\\\\\\\",
          "\\\\\\\\\\\\\\\\",
          "\\\\\\\\\\\\\\\\",
          "\\\\\\\\\\\\\\\\",
          "\\\\\\\\\\\\\\\\",
          "\\\\\\\\\\\\\\\\",
          "\\\\\\\\\\\\\\\\",
          "\\\\\\\\\\\\\\\\"
        ]
      },
      {
        "parts": [
          "\\\\\\\\\\\\\\\\",
          "\\\\\\\\\\\\\\\\",
          "\\\\\\\\\\\\\\\\",
          "\\\\\\\\\\\\\\\\",
          "\\\\\\\\\\\\\\\\",
          "\\\\\\\\\\\\\\\\",
          "\\\\\\\\\\\\\\\\",
          "\\\\\\\\\\\\\\\\",
          "\\\\\\\\\\\\\\\\",
          "\\\\\\\\\\\\\\\\",
          "\\\\\\\\\\\\\\\\",
          "\\\\\\\\\\\\\\\\",
          "\\\\\\\\\\\\\\\\",
          "\\\\\\\\\\\\\\\\",
          "\\\\\\\\\\\\\\\\",
          "\\\\\\\\\\\\\\\\",
          "\\\\\\\\\\\\\\\\",
          "\\\\\\\\\\\\\\\\",
          "\\\\\\\\\\\\\\\\",
          "\\\\\\\\\\\\\\\\",
          "\\\\\\\\\\\\\\\\"
        ]
      },
      {
        "parts": [
          "\\\\\\\\\\\\\\\\",
          "\\\\\\\\\\\\\\\\",
          "\\\\\\\\\\\\\\\\",
          "\\\\\\\\\\\\\\\\",
          "\\\\\\\\\\\\\\\\",
          "\\\\\\\\\\\\\\\\",
          "\\\\\\\\\\\\\\\\",
          "\\\\\\\\\\\\\\\\",
          "\\\\\\\\\\\\\\\\",
          "\\\\\\\\\\\\\\\\",
          "\\\\\\\\\\\\\\\\",
          "\\\\\\\\\\\\\\\\",
          "\\\\\\\\\\\\\\\\",
          "\\\\\\\\\\\\\\\\",
          "\\\\\\\\\\\\\\\\",
          "\\\\\\\\\\\\\\\\",
          "\\\\\\\\\\\\\\\\",
          "\\\\\\\\\\\\\\\\",
          "\\\\\\\\\\\\\\\\",
          "\\\\\\\\\\\\\\\\",
          "\\\\\\\\\\\\\\\\"
        ]
      },
      {
        "parts": [
          "\\\\\\\\\\\\\\\\",
          "\\\\\\\\\\\\\\\\",
          "\\\\\\\\\\\\\\\\",
          "\\\\\\\\\\\\\\\\",
          "\\\\\\\\\\\\\\\\",
          "\\\\\\\\\\\\\\\\",
          "\\\\\\\\\\\\\\\\",
          "\\\\\\\\\\\\\\\\",
          "\\\\\\\\\\\\\\\\",
          "\\\\\\\\\\\\\\\\",
          "\\\\\\\\\\\\\\\\",
          "\\\\\\\\\\\\\\\\",
          "\\\\\\\\\\\\\\\\",
          "\\\\\\\\\\\\\\\\",
          "\\\\\\\\\\\\\\\\",
          "\\\\\\\\\\\\\\\\",
          "\\\\\\\\\\\\\\\\",
          "\\\\\\\\\\\\\\\\",
          "\\\\\\\\\\\\\\\\",
          "\\\\\\\\\\\\\\\\",
          "\\\\\\\\\\\\\\\\"
        ]
      }
    ]
  },
  "taskbar": {
    "apps": [
      {
        "kind": "media",
        "running": false,
        "selected": false
      },
      {
        "kind": "folder",
        "running": true,
        "selected": false
      },
      {
        "kind": "globe",
        "running": true,
        "selected": false
      },
      {
        "kind": "fox",
        "running": true,
        "selected": false
      },
      {
        "kind": "ftp",
        "logo_text": "Fz",
        "running": true,
        "selected": false
      },
      {
        "kind": "paint",
        "running": true,
        "selected": false
      },
      {
        "kind": "notepad",
        "running": true,
        "selected": true
      }
    ],
    "tray": [
      {
        "kind": "caret"
      },
      {
        "kind": "ring"
      },
      {
        "kind": "signal"
      },
      {
        "kind": "flag"
      },
      {
        "kind": "plug"
      },
      {
        "kind": "slash"
      }
    ],
    "clock": {
      "time": "12:23 p.m.",
      "date": "14/07/2013"
    }
  }
}
